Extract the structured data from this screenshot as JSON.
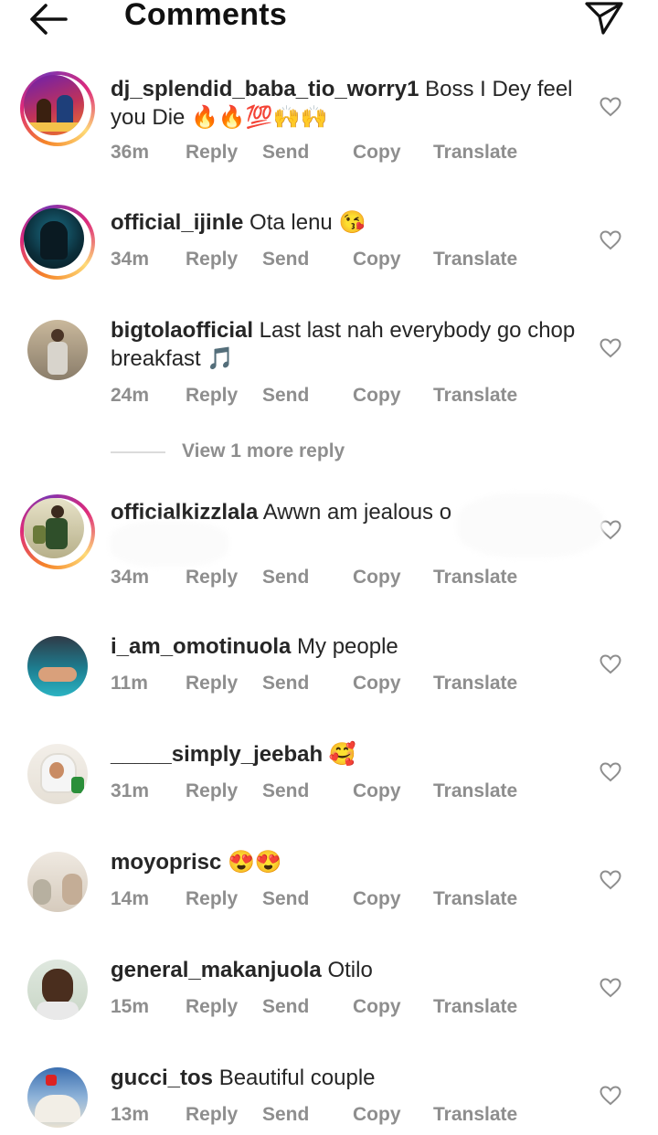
{
  "header": {
    "title": "Comments",
    "back_icon": "arrow-left-icon",
    "send_icon": "paper-plane-icon"
  },
  "actions": {
    "reply": "Reply",
    "send": "Send",
    "copy": "Copy",
    "translate": "Translate"
  },
  "comments": [
    {
      "user": "dj_splendid_baba_tio_worry1",
      "text": "Boss I Dey feel you Die 🔥🔥💯🙌🙌",
      "time": "36m",
      "story_ring": true
    },
    {
      "user": "official_ijinle",
      "text": "Ota lenu 😘",
      "time": "34m",
      "story_ring": true
    },
    {
      "user": "bigtolaofficial",
      "text": "Last last nah everybody go chop breakfast 🎵",
      "time": "24m",
      "story_ring": false
    },
    {
      "user": "officialkizzlala",
      "text": "Awwn am jealous o",
      "time": "34m",
      "story_ring": true
    },
    {
      "user": "i_am_omotinuola",
      "text": "My people",
      "time": "11m",
      "story_ring": false
    },
    {
      "user": "_____simply_jeebah",
      "text": "🥰",
      "time": "31m",
      "story_ring": false
    },
    {
      "user": "moyoprisc",
      "text": "😍😍",
      "time": "14m",
      "story_ring": false
    },
    {
      "user": "general_makanjuola",
      "text": "Otilo",
      "time": "15m",
      "story_ring": false
    },
    {
      "user": "gucci_tos",
      "text": "Beautiful couple",
      "time": "13m",
      "story_ring": false
    }
  ],
  "view_more_replies": "View 1 more reply",
  "colors": {
    "meta_gray": "#8e8e8e",
    "text": "#262626",
    "ring_start": "#f58529",
    "ring_end": "#dd2a7b"
  }
}
